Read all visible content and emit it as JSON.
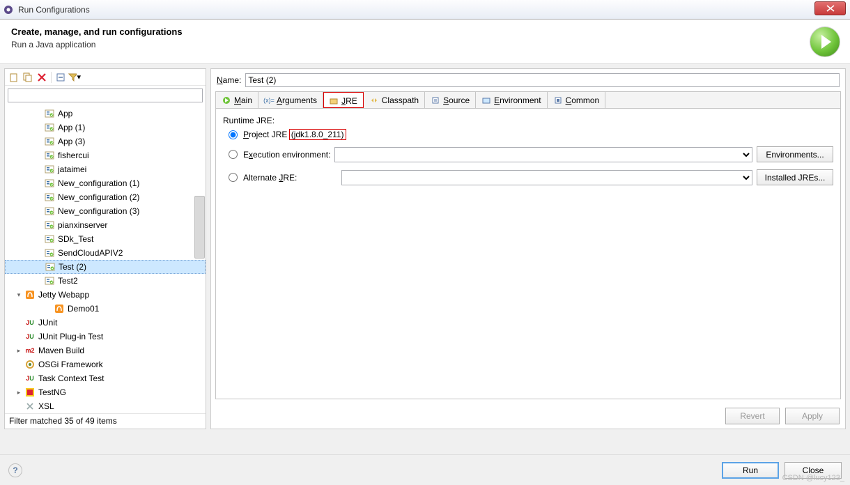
{
  "window": {
    "title": "Run Configurations"
  },
  "header": {
    "title": "Create, manage, and run configurations",
    "subtitle": "Run a Java application"
  },
  "toolbar_icons": [
    "new",
    "duplicate",
    "delete",
    "collapse",
    "filter"
  ],
  "filter": {
    "value": ""
  },
  "tree": [
    {
      "level": 1,
      "icon": "java",
      "label": "App"
    },
    {
      "level": 1,
      "icon": "java",
      "label": "App (1)"
    },
    {
      "level": 1,
      "icon": "java",
      "label": "App (3)"
    },
    {
      "level": 1,
      "icon": "java",
      "label": "fishercui"
    },
    {
      "level": 1,
      "icon": "java",
      "label": "jataimei"
    },
    {
      "level": 1,
      "icon": "java",
      "label": "New_configuration (1)"
    },
    {
      "level": 1,
      "icon": "java",
      "label": "New_configuration (2)"
    },
    {
      "level": 1,
      "icon": "java",
      "label": "New_configuration (3)"
    },
    {
      "level": 1,
      "icon": "java",
      "label": "pianxinserver"
    },
    {
      "level": 1,
      "icon": "java",
      "label": "SDk_Test"
    },
    {
      "level": 1,
      "icon": "java",
      "label": "SendCloudAPIV2"
    },
    {
      "level": 1,
      "icon": "java",
      "label": "Test (2)",
      "selected": true
    },
    {
      "level": 1,
      "icon": "java",
      "label": "Test2"
    },
    {
      "level": 0,
      "icon": "jetty",
      "label": "Jetty Webapp",
      "expander": "▾"
    },
    {
      "level": 2,
      "icon": "jetty",
      "label": "Demo01"
    },
    {
      "level": 0,
      "icon": "ju",
      "label": "JUnit"
    },
    {
      "level": 0,
      "icon": "jup",
      "label": "JUnit Plug-in Test"
    },
    {
      "level": 0,
      "icon": "m2",
      "label": "Maven Build",
      "expander": "▸"
    },
    {
      "level": 0,
      "icon": "osgi",
      "label": "OSGi Framework"
    },
    {
      "level": 0,
      "icon": "juc",
      "label": "Task Context Test"
    },
    {
      "level": 0,
      "icon": "testng",
      "label": "TestNG",
      "expander": "▸"
    },
    {
      "level": 0,
      "icon": "xsl",
      "label": "XSL"
    }
  ],
  "status": "Filter matched 35 of 49 items",
  "name_field": {
    "label_html": "Name:",
    "value": "Test (2)"
  },
  "tabs": [
    {
      "label": "Main",
      "mn": "M",
      "active": false,
      "highlight": false
    },
    {
      "label": "Arguments",
      "mn": "A",
      "active": false,
      "highlight": false
    },
    {
      "label": "JRE",
      "mn": "J",
      "active": true,
      "highlight": true
    },
    {
      "label": "Classpath",
      "mn": "",
      "active": false,
      "highlight": false
    },
    {
      "label": "Source",
      "mn": "S",
      "active": false,
      "highlight": false
    },
    {
      "label": "Environment",
      "mn": "E",
      "active": false,
      "highlight": false
    },
    {
      "label": "Common",
      "mn": "C",
      "active": false,
      "highlight": false
    }
  ],
  "jre": {
    "section": "Runtime JRE:",
    "project_label": "Project JRE",
    "project_mn": "P",
    "project_value": "(jdk1.8.0_211)",
    "exec_label": "Execution environment:",
    "exec_mn": "x",
    "alt_label": "Alternate JRE:",
    "alt_mn": "J",
    "environments_btn": "Environments...",
    "installed_btn": "Installed JREs..."
  },
  "buttons": {
    "revert": "Revert",
    "apply": "Apply",
    "run": "Run",
    "close": "Close"
  },
  "watermark": "CSDN @lucy123_"
}
